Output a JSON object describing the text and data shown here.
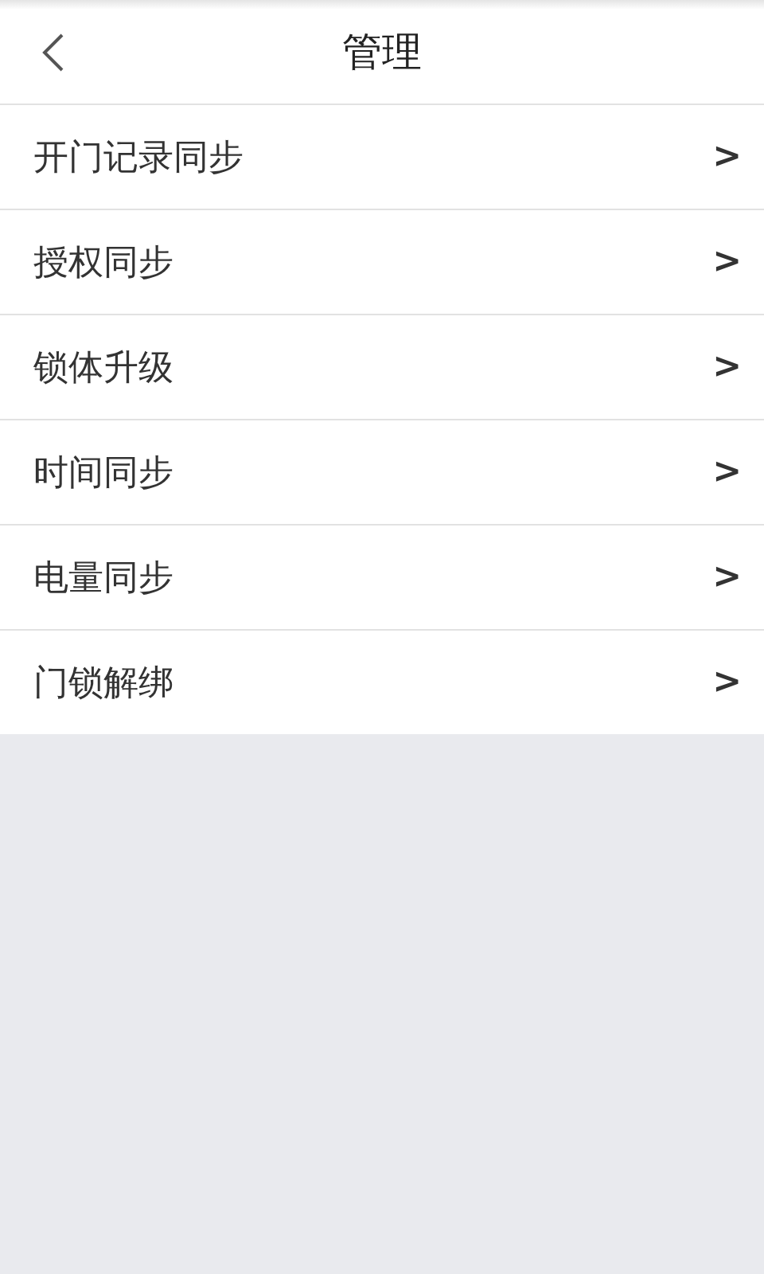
{
  "header": {
    "title": "管理"
  },
  "menu_items": [
    {
      "label": "开门记录同步",
      "arrow": ">"
    },
    {
      "label": "授权同步",
      "arrow": ">"
    },
    {
      "label": "锁体升级",
      "arrow": ">"
    },
    {
      "label": "时间同步",
      "arrow": ">"
    },
    {
      "label": "电量同步",
      "arrow": ">"
    },
    {
      "label": "门锁解绑",
      "arrow": ">"
    }
  ]
}
